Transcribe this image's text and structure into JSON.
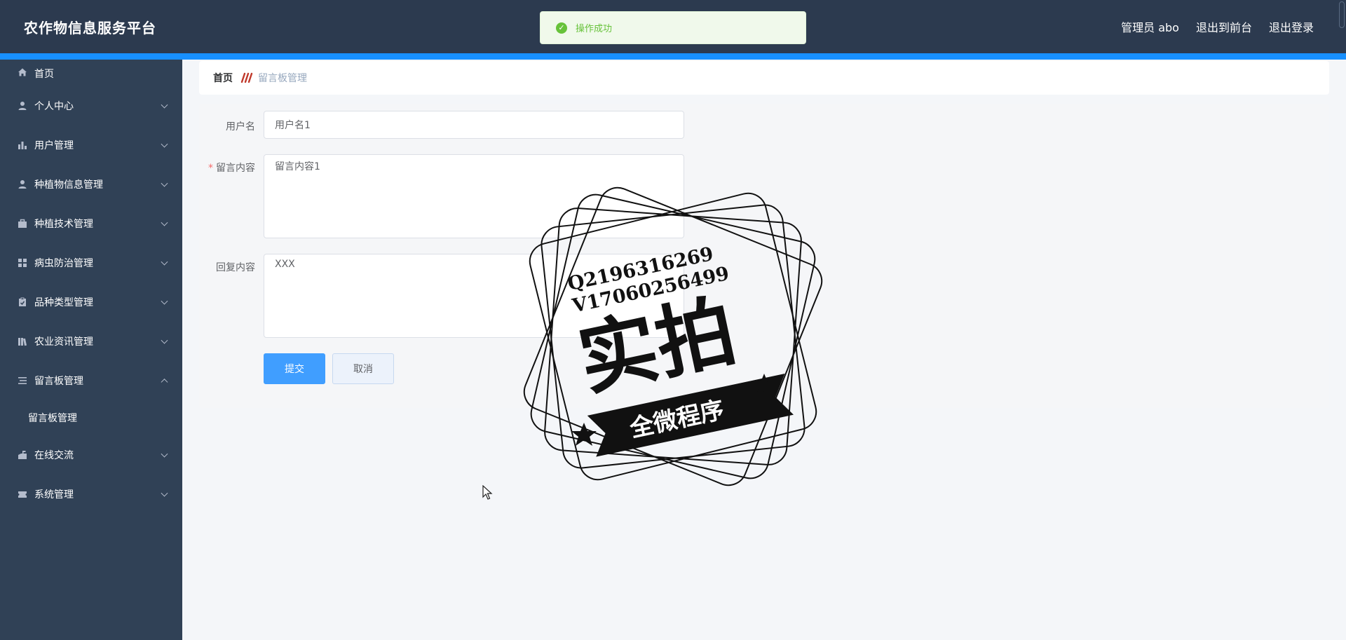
{
  "header": {
    "title": "农作物信息服务平台",
    "user": "管理员 abo",
    "to_front": "退出到前台",
    "logout": "退出登录"
  },
  "toast": {
    "text": "操作成功"
  },
  "sidebar": {
    "items": [
      {
        "label": "首页",
        "icon": "home-icon"
      },
      {
        "label": "个人中心",
        "icon": "person-icon"
      },
      {
        "label": "用户管理",
        "icon": "bar-chart-icon"
      },
      {
        "label": "种植物信息管理",
        "icon": "person-icon"
      },
      {
        "label": "种植技术管理",
        "icon": "briefcase-icon"
      },
      {
        "label": "病虫防治管理",
        "icon": "grid-icon"
      },
      {
        "label": "品种类型管理",
        "icon": "clipboard-icon"
      },
      {
        "label": "农业资讯管理",
        "icon": "library-icon"
      },
      {
        "label": "留言板管理",
        "icon": "list-icon"
      },
      {
        "label": "在线交流",
        "icon": "mailbox-icon"
      },
      {
        "label": "系统管理",
        "icon": "ticket-icon"
      }
    ],
    "sub_item": "留言板管理"
  },
  "breadcrumb": {
    "home": "首页",
    "current": "留言板管理"
  },
  "form": {
    "username_label": "用户名",
    "username_value": "用户名1",
    "content_label": "留言内容",
    "content_value": "留言内容1",
    "reply_label": "回复内容",
    "reply_value": "XXX",
    "submit": "提交",
    "cancel": "取消"
  },
  "watermark": {
    "line1": "Q2196316269",
    "line2": "V17060256499",
    "main": "实拍",
    "banner": "全微程序"
  },
  "colors": {
    "header_bg": "#2c3a4f",
    "accent_bar": "#1890ff",
    "sidebar_bg": "#304156",
    "primary": "#409eff",
    "success": "#67c23a"
  }
}
